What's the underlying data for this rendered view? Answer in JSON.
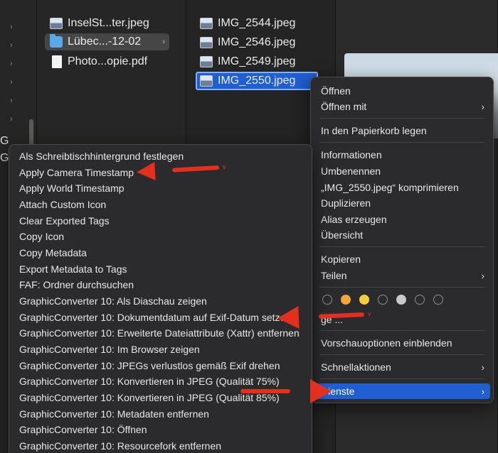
{
  "finder": {
    "column_files": [
      {
        "name": "InselSt...ter.jpeg",
        "icon": "image-file-icon"
      },
      {
        "name": "Lübec...-12-02",
        "icon": "folder-icon"
      },
      {
        "name": "Photo...opie.pdf",
        "icon": "pdf-file-icon"
      }
    ],
    "column_images": [
      {
        "name": "IMG_2544.jpeg"
      },
      {
        "name": "IMG_2546.jpeg"
      },
      {
        "name": "IMG_2549.jpeg"
      },
      {
        "name": "IMG_2550.jpeg"
      }
    ],
    "edge_letters": [
      "G",
      "G"
    ]
  },
  "context_menu": {
    "items": [
      {
        "label": "Öffnen"
      },
      {
        "label": "Öffnen mit",
        "submenu": true
      },
      {
        "label": "In den Papierkorb legen"
      },
      {
        "label": "Informationen"
      },
      {
        "label": "Umbenennen"
      },
      {
        "label": "„IMG_2550.jpeg“ komprimieren"
      },
      {
        "label": "Duplizieren"
      },
      {
        "label": "Alias erzeugen"
      },
      {
        "label": "Übersicht"
      },
      {
        "label": "Kopieren"
      },
      {
        "label": "Teilen",
        "submenu": true
      },
      {
        "label": "Vorschauoptionen einblenden"
      },
      {
        "label": "Schnellaktionen",
        "submenu": true
      },
      {
        "label": "Dienste",
        "submenu": true,
        "active": true
      }
    ],
    "partial_label": "ge ...",
    "tag_colors": [
      "empty",
      "#f0a43a",
      "#f2cf3a",
      "empty",
      "#c9c9c9",
      "empty",
      "empty"
    ]
  },
  "services_menu": {
    "items": [
      "Als Schreibtischhintergrund festlegen",
      "Apply Camera Timestamp",
      "Apply World Timestamp",
      "Attach Custom Icon",
      "Clear Exported Tags",
      "Copy Icon",
      "Copy Metadata",
      "Export Metadata to Tags",
      "FAF: Ordner durchsuchen",
      "GraphicConverter 10: Als Diaschau zeigen",
      "GraphicConverter 10: Dokumentdatum auf Exif-Datum setzen",
      "GraphicConverter 10: Erweiterte Dateiattribute (Xattr) entfernen",
      "GraphicConverter 10: Im Browser zeigen",
      "GraphicConverter 10: JPEGs verlustlos gemäß Exif drehen",
      "GraphicConverter 10: Konvertieren in JPEG (Qualität 75%)",
      "GraphicConverter 10: Konvertieren in JPEG (Qualität 85%)",
      "GraphicConverter 10: Metadaten entfernen",
      "GraphicConverter 10: Öffnen",
      "GraphicConverter 10: Resourcefork entfernen"
    ]
  },
  "annotations": {
    "arrow_color": "#e3301e",
    "tick": "v"
  }
}
